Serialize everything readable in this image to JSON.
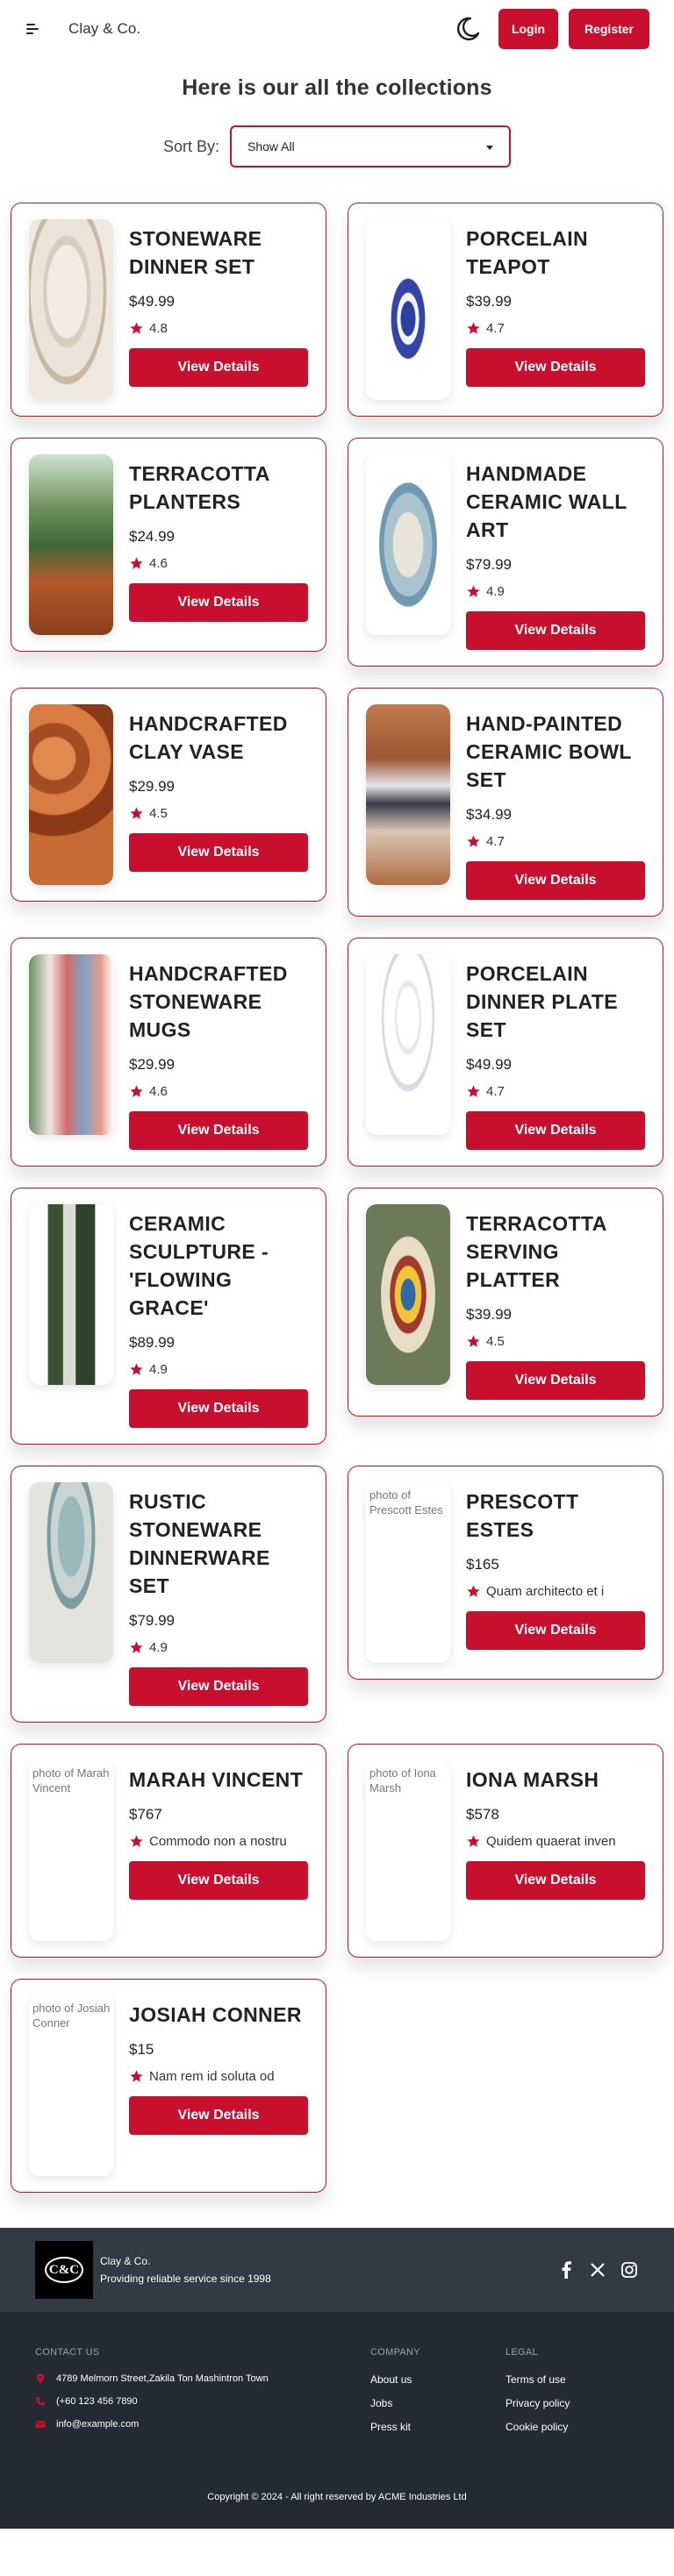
{
  "nav": {
    "brand": "Clay & Co.",
    "login_label": "Login",
    "register_label": "Register"
  },
  "page": {
    "heading": "Here is our all the collections",
    "sort_label": "Sort By:",
    "sort_selected": "Show All"
  },
  "colors": {
    "accent": "#c8102e",
    "footer_top": "#323a45",
    "footer_bottom": "#232a33"
  },
  "products": [
    {
      "title": "Stoneware Dinner Set",
      "price": "$49.99",
      "rating": "4.8",
      "image_alt": "",
      "button": "View Details"
    },
    {
      "title": "Porcelain Teapot",
      "price": "$39.99",
      "rating": "4.7",
      "image_alt": "",
      "button": "View Details"
    },
    {
      "title": "Terracotta Planters",
      "price": "$24.99",
      "rating": "4.6",
      "image_alt": "",
      "button": "View Details"
    },
    {
      "title": "Handmade Ceramic Wall Art",
      "price": "$79.99",
      "rating": "4.9",
      "image_alt": "",
      "button": "View Details"
    },
    {
      "title": "Handcrafted Clay Vase",
      "price": "$29.99",
      "rating": "4.5",
      "image_alt": "",
      "button": "View Details"
    },
    {
      "title": "Hand-Painted Ceramic Bowl Set",
      "price": "$34.99",
      "rating": "4.7",
      "image_alt": "",
      "button": "View Details"
    },
    {
      "title": "Handcrafted Stoneware Mugs",
      "price": "$29.99",
      "rating": "4.6",
      "image_alt": "",
      "button": "View Details"
    },
    {
      "title": "Porcelain Dinner Plate Set",
      "price": "$49.99",
      "rating": "4.7",
      "image_alt": "",
      "button": "View Details"
    },
    {
      "title": "Ceramic Sculpture - 'Flowing Grace'",
      "price": "$89.99",
      "rating": "4.9",
      "image_alt": "",
      "button": "View Details"
    },
    {
      "title": "Terracotta Serving Platter",
      "price": "$39.99",
      "rating": "4.5",
      "image_alt": "",
      "button": "View Details"
    },
    {
      "title": "Rustic Stoneware Dinnerware Set",
      "price": "$79.99",
      "rating": "4.9",
      "image_alt": "",
      "button": "View Details"
    },
    {
      "title": "Prescott Estes",
      "price": "$165",
      "rating": "Quam architecto et i",
      "image_alt": "photo of Prescott Estes",
      "button": "View Details"
    },
    {
      "title": "Marah Vincent",
      "price": "$767",
      "rating": "Commodo non a nostru",
      "image_alt": "photo of Marah Vincent",
      "button": "View Details"
    },
    {
      "title": "Iona Marsh",
      "price": "$578",
      "rating": "Quidem quaerat inven",
      "image_alt": "photo of Iona Marsh",
      "button": "View Details"
    },
    {
      "title": "Josiah Conner",
      "price": "$15",
      "rating": "Nam rem id soluta od",
      "image_alt": "photo of Josiah Conner",
      "button": "View Details"
    }
  ],
  "footer": {
    "logo_text": "C&C",
    "brand_name": "Clay & Co.",
    "tagline": "Providing reliable service since 1998",
    "contact_heading": "Contact Us",
    "address": "4789 Melmorn Street,Zakila Ton Mashintron Town",
    "phone": "(+60 123 456 7890",
    "email": "info@example.com",
    "company_heading": "Company",
    "company_links": [
      "About us",
      "Jobs",
      "Press kit"
    ],
    "legal_heading": "Legal",
    "legal_links": [
      "Terms of use",
      "Privacy policy",
      "Cookie policy"
    ],
    "copyright": "Copyright © 2024 - All right reserved by ACME Industries Ltd"
  }
}
